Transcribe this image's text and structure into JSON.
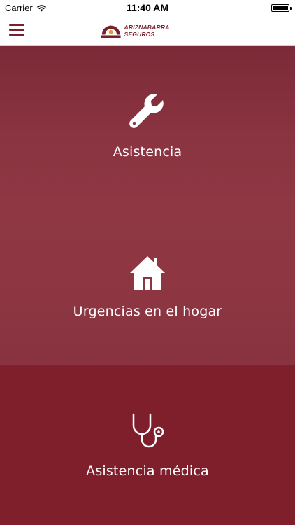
{
  "status_bar": {
    "carrier": "Carrier",
    "time": "11:40 AM"
  },
  "header": {
    "logo_text": "ARIZNABARRA SEGUROS",
    "menu_icon": "hamburger-icon"
  },
  "colors": {
    "brand": "#7a1f2e",
    "panel_dark": "#7f1f2c"
  },
  "panels": [
    {
      "label": "Asistencia",
      "icon": "wrench-icon"
    },
    {
      "label": "Urgencias en el hogar",
      "icon": "house-icon"
    },
    {
      "label": "Asistencia médica",
      "icon": "stethoscope-icon"
    }
  ]
}
